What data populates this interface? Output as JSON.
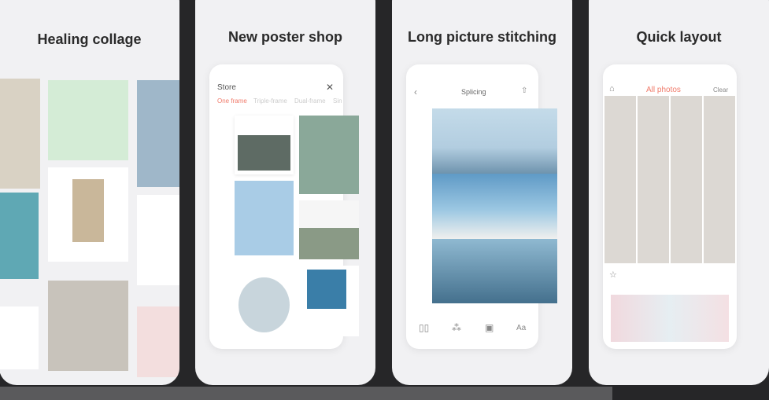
{
  "cards": [
    {
      "title": "Healing collage"
    },
    {
      "title": "New poster shop",
      "store": {
        "heading": "Store",
        "tabs": [
          "One frame",
          "Triple-frame",
          "Dual-frame",
          "Sin"
        ]
      }
    },
    {
      "title": "Long picture stitching",
      "header": {
        "title": "Splicing"
      },
      "tools": [
        "layout-icon",
        "filter-icon",
        "frame-icon",
        "Aa"
      ]
    },
    {
      "title": "Quick layout",
      "header": {
        "album": "All photos",
        "clear": "Clear"
      }
    }
  ],
  "colors": {
    "accent": "#f07a6a",
    "background": "#262628"
  }
}
